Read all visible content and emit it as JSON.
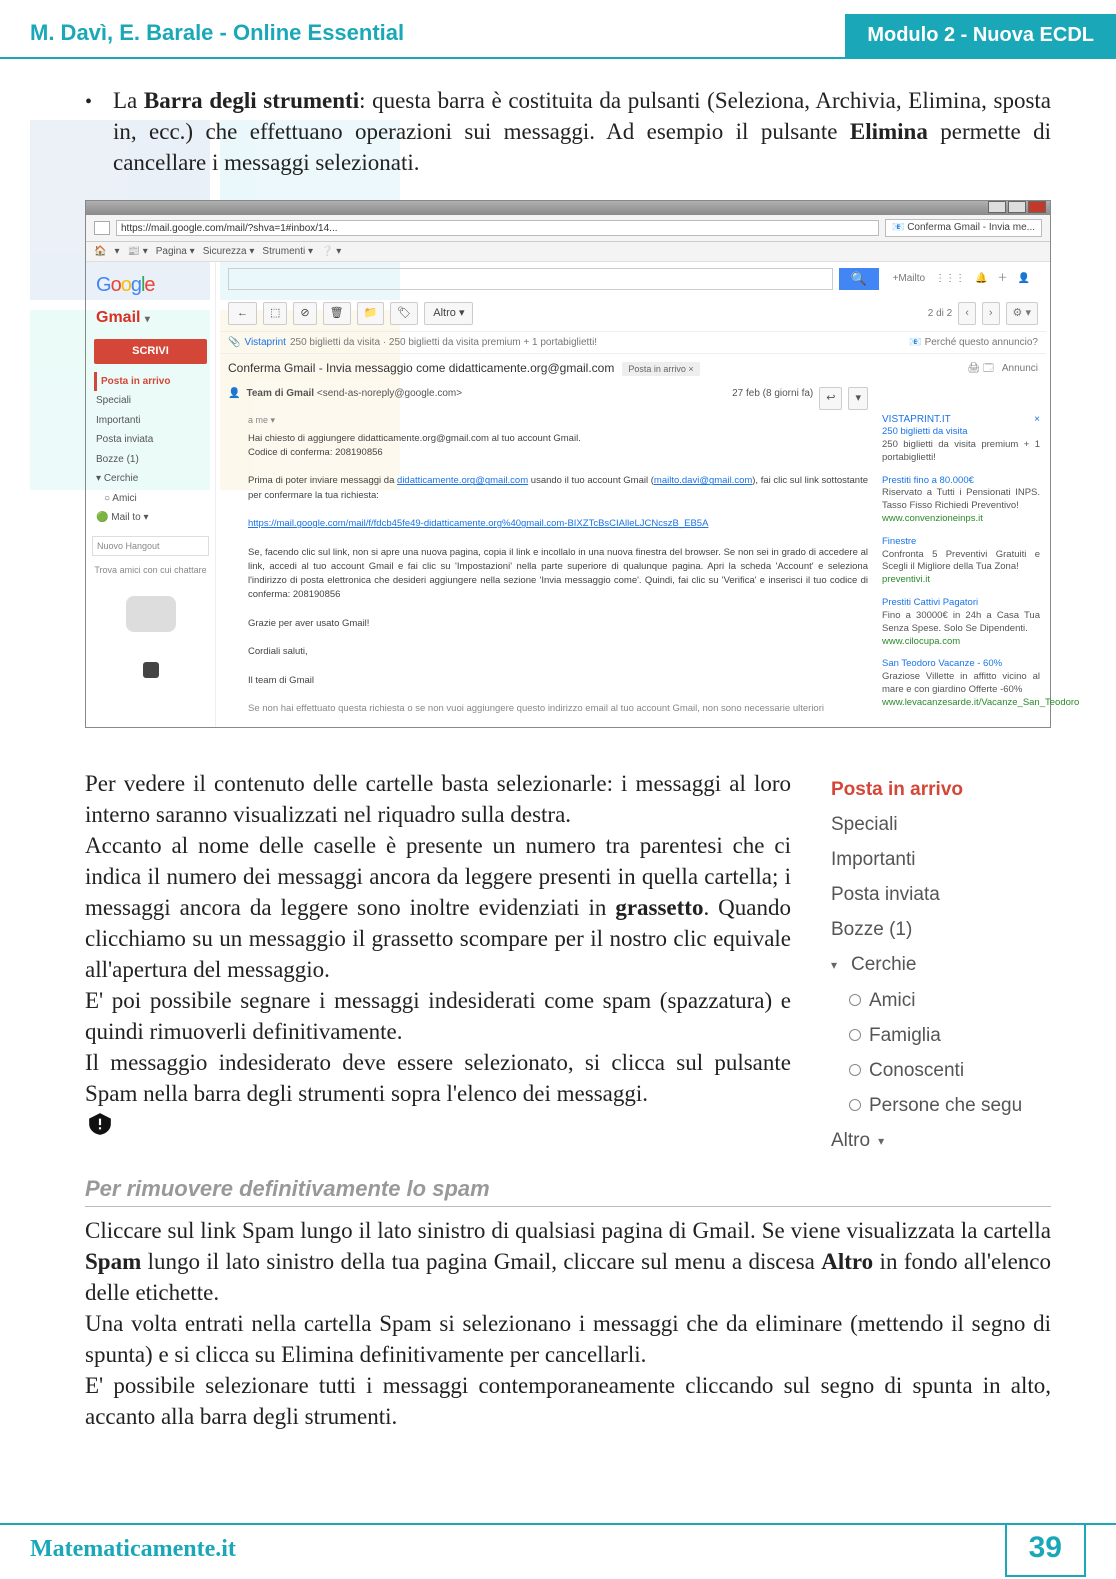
{
  "header": {
    "left": "M. Davì, E. Barale - Online Essential",
    "right": "Modulo 2 - Nuova ECDL"
  },
  "bullet": {
    "lead": "La ",
    "bold1": "Barra degli strumenti",
    "rest1": ": questa barra è costituita da pulsanti (Seleziona, Archivia, Elimina, sposta in, ecc.) che effettuano operazioni sui messaggi. Ad esempio il pulsante ",
    "bold2": "Elimina",
    "rest2": " permette di cancellare i messaggi selezionati."
  },
  "gmail": {
    "url": "https://mail.google.com/mail/?shva=1#inbox/14...",
    "tab": "Conferma Gmail - Invia me...",
    "menu": [
      "Pagina",
      "Sicurezza",
      "Strumenti"
    ],
    "google": [
      "G",
      "o",
      "o",
      "g",
      "l",
      "e"
    ],
    "brand": "Gmail",
    "compose": "SCRIVI",
    "nav": {
      "inbox": "Posta in arrivo",
      "starred": "Speciali",
      "important": "Importanti",
      "sent": "Posta inviata",
      "drafts": "Bozze (1)",
      "circles": "Cerchie",
      "friends": "Amici",
      "mailto": "Mail to"
    },
    "hangout_new": "Nuovo Hangout",
    "hangout_hint": "Trova amici con cui chattare",
    "plus": "+Mailto",
    "toolbar": {
      "back": "←",
      "archive": "⬚",
      "spam": "⊘",
      "delete": "🗑",
      "move": "📁",
      "labels": "🏷",
      "more": "Altro ▾"
    },
    "pager": "2 di 2",
    "promo_brand": "Vistaprint",
    "promo_text": "250 biglietti da visita · 250 biglietti da visita premium + 1 portabiglietti!",
    "promo_link": "Perché questo annuncio?",
    "subject": "Conferma Gmail - Invia messaggio come didatticamente.org@gmail.com",
    "subject_label": "Posta in arrivo",
    "annunci": "Annunci",
    "from_name": "Team di Gmail",
    "from_addr": "<send-as-noreply@google.com>",
    "from_date": "27 feb (8 giorni fa)",
    "to": "a me",
    "body": {
      "l1": "Hai chiesto di aggiungere didatticamente.org@gmail.com al tuo account Gmail.",
      "l2": "Codice di conferma: 208190856",
      "l3a": "Prima di poter inviare messaggi da ",
      "l3b": "didatticamente.org@gmail.com",
      "l3c": " usando il tuo account Gmail (",
      "l3d": "mailto.davi@gmail.com",
      "l3e": "), fai clic sul link sottostante per confermare la tua richiesta:",
      "link": "https://mail.google.com/mail/f/fdcb45fe49-didatticamente.org%40gmail.com-BIXZTcBsCIAlleLJCNcszB_EB5A",
      "l4": "Se, facendo clic sul link, non si apre una nuova pagina, copia il link e incollalo in una nuova finestra del browser. Se non sei in grado di accedere al link, accedi al tuo account Gmail e fai clic su 'Impostazioni' nella parte superiore di qualunque pagina. Apri la scheda 'Account' e seleziona l'indirizzo di posta elettronica che desideri aggiungere nella sezione 'Invia messaggio come'. Quindi, fai clic su 'Verifica' e inserisci il tuo codice di conferma: 208190856",
      "l5": "Grazie per aver usato Gmail!",
      "l6": "Cordiali saluti,",
      "l7": "Il team di Gmail",
      "l8": "Se non hai effettuato questa richiesta o se non vuoi aggiungere questo indirizzo email al tuo account Gmail, non sono necessarie ulteriori"
    },
    "ads": {
      "t1": "VISTAPRINT.IT",
      "a1a": "250 biglietti da visita",
      "a1b": "250 biglietti da visita premium + 1 portabiglietti!",
      "t2": "Prestiti fino a 80.000€",
      "a2a": "Riservato a Tutti i Pensionati INPS. Tasso Fisso Richiedi Preventivo!",
      "a2b": "www.convenzioneinps.it",
      "t3": "Finestre",
      "a3a": "Confronta 5 Preventivi Gratuiti e Scegli il Migliore della Tua Zona!",
      "a3b": "preventivi.it",
      "t4": "Prestiti Cattivi Pagatori",
      "a4a": "Fino a 30000€ in 24h a Casa Tua Senza Spese. Solo Se Dipendenti.",
      "a4b": "www.cilocupa.com",
      "t5": "San Teodoro Vacanze - 60%",
      "a5a": "Graziose Villette in affitto vicino al mare e con giardino Offerte -60%",
      "a5b": "www.levacanzesarde.it/Vacanze_San_Teodoro"
    }
  },
  "para2": {
    "p1": "Per vedere il contenuto delle cartelle basta selezionarle: i messaggi al loro interno saranno visualizzati nel riquadro sulla destra.",
    "p2a": "Accanto al nome delle caselle è presente un numero tra parentesi che ci indica il numero dei messaggi ancora da leggere presenti in quella cartella; i messaggi ancora da leggere sono inoltre evidenziati in ",
    "p2b": "grassetto",
    "p2c": ". Quando clicchiamo su un messaggio il grassetto scompare per il nostro clic equivale all'apertura del messaggio.",
    "p3": "E' poi possibile segnare i messaggi indesiderati come spam (spazzatura) e quindi rimuoverli definitivamente.",
    "p4": "Il messaggio indesiderato deve essere selezionato, si clicca sul pulsante Spam nella barra degli strumenti sopra l'elenco dei messaggi."
  },
  "sidebar": {
    "inbox": "Posta in arrivo",
    "starred": "Speciali",
    "important": "Importanti",
    "sent": "Posta inviata",
    "drafts": "Bozze (1)",
    "circles": "Cerchie",
    "friends": "Amici",
    "family": "Famiglia",
    "known": "Conoscenti",
    "follow": "Persone che segu",
    "more": "Altro"
  },
  "section_heading": "Per rimuovere definitivamente lo spam",
  "para3": {
    "p1a": "Cliccare sul link Spam lungo il lato sinistro di qualsiasi pagina di Gmail. Se viene visualizzata la cartella ",
    "p1b": "Spam",
    "p1c": " lungo il lato sinistro della tua pagina Gmail, cliccare sul menu a discesa ",
    "p1d": "Altro",
    "p1e": " in fondo all'elenco delle etichette.",
    "p2": "Una volta entrati nella cartella Spam si selezionano i messaggi che da eliminare (mettendo il segno di spunta) e si clicca su Elimina definitivamente per cancellarli.",
    "p3": "E' possibile selezionare tutti i messaggi contemporaneamente cliccando sul segno di spunta in alto, accanto alla barra degli strumenti."
  },
  "footer": {
    "site": "Matematicamente.it",
    "page": "39"
  }
}
